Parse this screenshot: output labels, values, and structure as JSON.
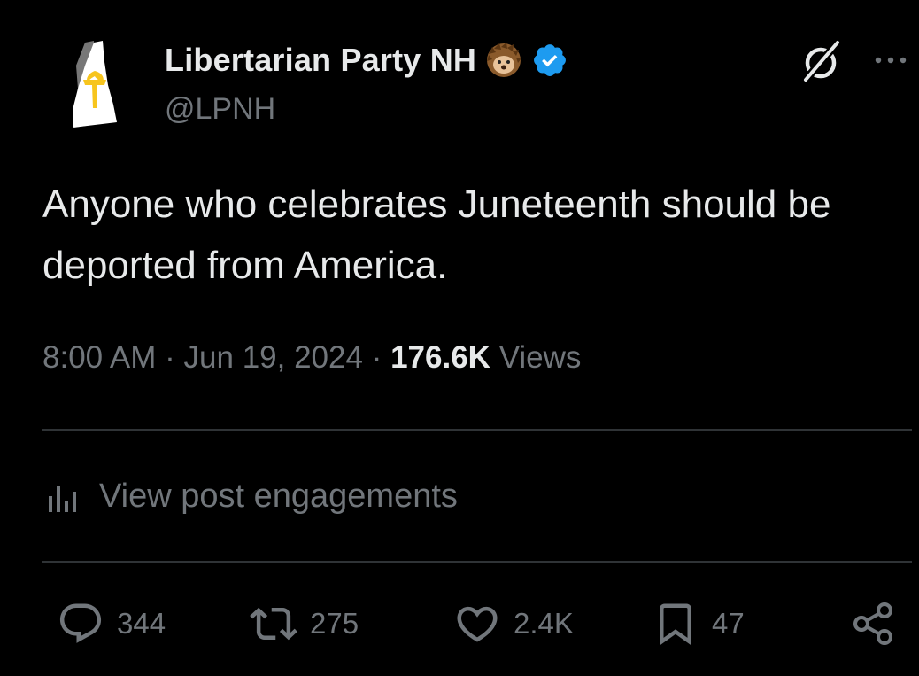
{
  "author": {
    "display_name": "Libertarian Party NH",
    "handle": "@LPNH",
    "badge_emoji": "hedgehog",
    "verified_icon": "verified-badge-icon",
    "colors": {
      "verified_blue": "#1d9bf0",
      "text_primary": "#e7e9ea",
      "text_secondary": "#71767b",
      "divider": "#2f3336",
      "torch_yellow": "#f7c51e"
    }
  },
  "post": {
    "text": "Anyone who celebrates Juneteenth should be deported from America.",
    "time": "8:00 AM",
    "separator": "·",
    "date": "Jun 19, 2024",
    "views_count": "176.6K",
    "views_label": "Views"
  },
  "engagements": {
    "label": "View post engagements",
    "icon": "analytics-bars-icon"
  },
  "actions": {
    "replies": "344",
    "reposts": "275",
    "likes": "2.4K",
    "bookmarks": "47"
  }
}
